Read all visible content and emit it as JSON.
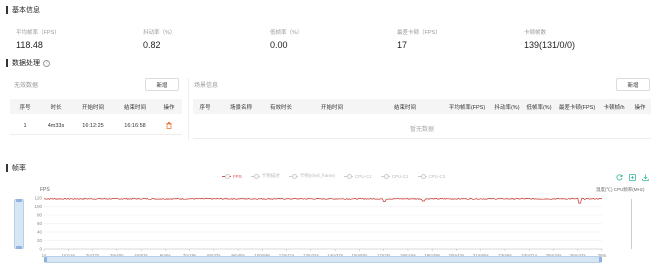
{
  "basic": {
    "title": "基本信息",
    "stats": [
      {
        "label": "平均帧率（FPS）",
        "value": "118.48"
      },
      {
        "label": "抖动率（%）",
        "value": "0.82"
      },
      {
        "label": "低帧率（%）",
        "value": "0.00"
      },
      {
        "label": "最差卡顿（FPS）",
        "value": "17"
      },
      {
        "label": "卡顿帧数",
        "value": "139(131/0/0)"
      }
    ]
  },
  "data_processing": {
    "title": "数据处理",
    "help_icon": "question-circle-icon",
    "left": {
      "header": "无效数据",
      "add_label": "新增",
      "columns": [
        "序号",
        "时长",
        "开始时间",
        "结束时间",
        "操作"
      ],
      "rows": [
        {
          "index": "1",
          "duration": "4m33s",
          "start": "16:12:25",
          "end": "16:16:58",
          "action_icon": "delete-icon"
        }
      ]
    },
    "right": {
      "header": "场景信息",
      "add_label": "新增",
      "columns": [
        "序号",
        "场景名称",
        "有效时长",
        "开始时间",
        "结束时间",
        "平均帧率(FPS)",
        "抖动率(%)",
        "低帧率(%)",
        "最差卡顿(FPS)",
        "卡顿帧/h",
        "操作"
      ],
      "empty_text": "暂无数据"
    }
  },
  "fps_section": {
    "title": "帧率",
    "legend": [
      {
        "name": "FPS",
        "color": "#d9534f",
        "active": true
      },
      {
        "name": "卡顿描述",
        "active": false
      },
      {
        "name": "卡顿(shell_frame)",
        "active": false
      },
      {
        "name": "CPU-C1",
        "active": false
      },
      {
        "name": "CPU-C2",
        "active": false
      },
      {
        "name": "CPU-C3",
        "active": false
      }
    ],
    "toolbar_icons": [
      "refresh-icon",
      "zoom-icon",
      "download-icon"
    ],
    "y_left_title": "FPS",
    "y_right_title": "温度(℃) CPU频率(MHz)"
  },
  "chart_data": {
    "type": "line",
    "xlabel": "",
    "ylabel": "FPS",
    "ylim": [
      0,
      120
    ],
    "y_ticks": [
      0,
      20,
      40,
      60,
      80,
      100,
      120
    ],
    "x_ticks": [
      "1s",
      "1m14s",
      "2m27s",
      "3m40s",
      "4m53s",
      "6m6s",
      "7m19s",
      "8m32s",
      "9m45s",
      "10m58s",
      "12m11s",
      "13m24s",
      "14m37s",
      "15m50s",
      "17m3s",
      "18m16s",
      "19m29s",
      "20m42s",
      "21m55s",
      "23m8s",
      "24m21s",
      "25m34s",
      "26m47s",
      "28m"
    ],
    "grid": true,
    "series": [
      {
        "name": "FPS",
        "color": "#c9302c",
        "typical_value": 118,
        "dips": [
          {
            "x_frac": 0.61,
            "value": 112
          },
          {
            "x_frac": 0.68,
            "value": 113
          },
          {
            "x_frac": 0.96,
            "value": 108
          }
        ]
      }
    ]
  }
}
